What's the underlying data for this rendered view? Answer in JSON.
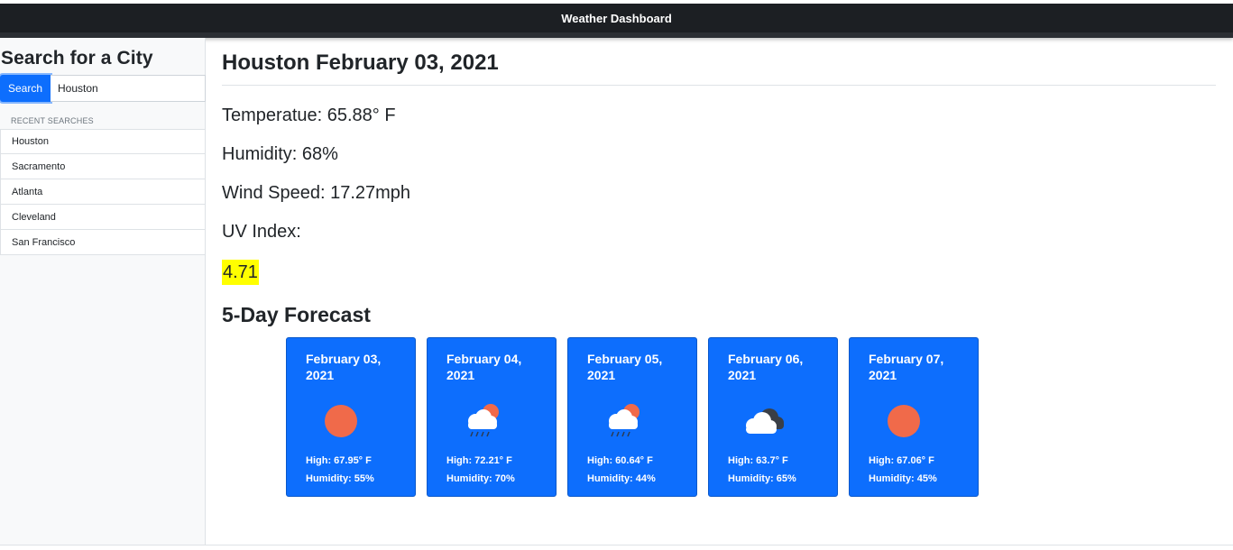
{
  "navbar": {
    "title": "Weather Dashboard"
  },
  "sidebar": {
    "heading": "Search for a City",
    "search_button": "Search",
    "search_value": "Houston",
    "recent_label": "RECENT SEARCHES",
    "recent": [
      "Houston",
      "Sacramento",
      "Atlanta",
      "Cleveland",
      "San Francisco"
    ]
  },
  "current": {
    "title": "Houston February 03, 2021",
    "temperature": "Temperatue: 65.88° F",
    "humidity": "Humidity: 68%",
    "wind": "Wind Speed: 17.27mph",
    "uv_label": "UV Index:",
    "uv_value": "4.71",
    "uv_color": "#ffff00"
  },
  "forecast": {
    "title": "5-Day Forecast",
    "days": [
      {
        "date": "February 03, 2021",
        "icon": "sun-icon",
        "high": "High: 67.95° F",
        "humidity": "Humidity: 55%"
      },
      {
        "date": "February 04, 2021",
        "icon": "rain-sun-icon",
        "high": "High: 72.21° F",
        "humidity": "Humidity: 70%"
      },
      {
        "date": "February 05, 2021",
        "icon": "rain-sun-icon",
        "high": "High: 60.64° F",
        "humidity": "Humidity: 44%"
      },
      {
        "date": "February 06, 2021",
        "icon": "cloudy-icon",
        "high": "High: 63.7° F",
        "humidity": "Humidity: 65%"
      },
      {
        "date": "February 07, 2021",
        "icon": "sun-icon",
        "high": "High: 67.06° F",
        "humidity": "Humidity: 45%"
      }
    ]
  },
  "colors": {
    "accent": "#0d6efd",
    "navbar": "#1c1f23",
    "sun": "#f06a4a"
  }
}
